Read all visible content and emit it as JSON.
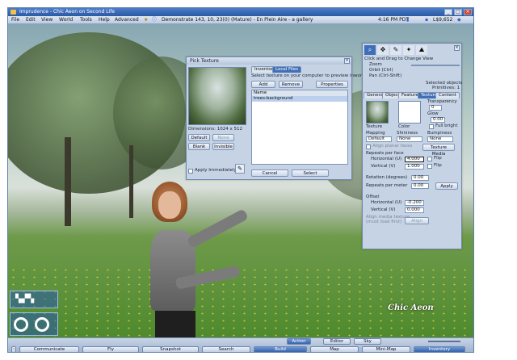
{
  "window": {
    "title": "Imprudence - Chic Aeon on Second Life"
  },
  "menubar": {
    "items": [
      "File",
      "Edit",
      "View",
      "World",
      "Tools",
      "Help",
      "Advanced"
    ],
    "location": "Demonstrate 143, 10, 23(0) (Mature) - En Plein Aire - a gallery",
    "time": "4:16 PM PDT",
    "balance": "L$9,652"
  },
  "pick_texture": {
    "title": "Pick Texture",
    "tabs": [
      "Inventory",
      "Local Files"
    ],
    "active_tab": 1,
    "hint": "Select texture on your computer to preview inworld",
    "add_label": "Add",
    "remove_label": "Remove",
    "properties_label": "Properties",
    "list_header": "Name",
    "list_items": [
      "trees-background"
    ],
    "dimensions": "Dimensions: 1024 x 512",
    "default_label": "Default",
    "none_label": "None",
    "blank_label": "Blank",
    "invisible_label": "Invisible",
    "apply_immediately": "Apply Immediately",
    "cancel_label": "Cancel",
    "select_label": "Select"
  },
  "build": {
    "tool_hint": "Click and Drag to Change View",
    "zoom": "Zoom",
    "orbit": "Orbit (Ctrl)",
    "pan": "Pan (Ctrl-Shift)",
    "selected_objects": "Selected objects",
    "primitives": "Primitives: 1",
    "tabs": [
      "General",
      "Object",
      "Features",
      "Texture",
      "Content"
    ],
    "active_tab": 3,
    "texture_label": "Texture",
    "color_label": "Color",
    "transparency_label": "Transparency",
    "transparency_value": "0",
    "glow_label": "Glow",
    "glow_value": "0.00",
    "fullbright": "Full bright",
    "mapping_label": "Mapping",
    "mapping_value": "Default",
    "shininess_label": "Shininess",
    "shininess_value": "None",
    "bumpiness_label": "Bumpiness",
    "bumpiness_value": "None",
    "align_planar": "Align planar faces",
    "texture_media": "Texture Media",
    "repeats_per_face": "Repeats per face",
    "horizontal_u": "Horizontal (U)",
    "horizontal_u_value": "4.000",
    "vertical_v": "Vertical (V)",
    "vertical_v_value": "1.000",
    "flip": "Flip",
    "rotation_label": "Rotation (degrees)",
    "rotation_value": "0.00",
    "repeats_per_meter": "Repeats per meter",
    "repeats_per_meter_value": "0.00",
    "apply_label": "Apply",
    "offset_label": "Offset",
    "offset_u_label": "Horizontal (U)",
    "offset_u_value": "-0.200",
    "offset_v_label": "Vertical (V)",
    "offset_v_value": "0.000",
    "align_media": "Align media texture",
    "align_media_sub": "(must load first)",
    "align_label": "Align"
  },
  "bottombar": {
    "toolbar_top": [
      "Action",
      "Editor",
      "Sky"
    ],
    "buttons": [
      "Communicate",
      "Fly",
      "Snapshot",
      "Search",
      "Build",
      "Map",
      "Mini-Map",
      "Inventory"
    ],
    "highlighted": [
      "Build",
      "Inventory"
    ]
  },
  "watermark": "Chic Aeon"
}
